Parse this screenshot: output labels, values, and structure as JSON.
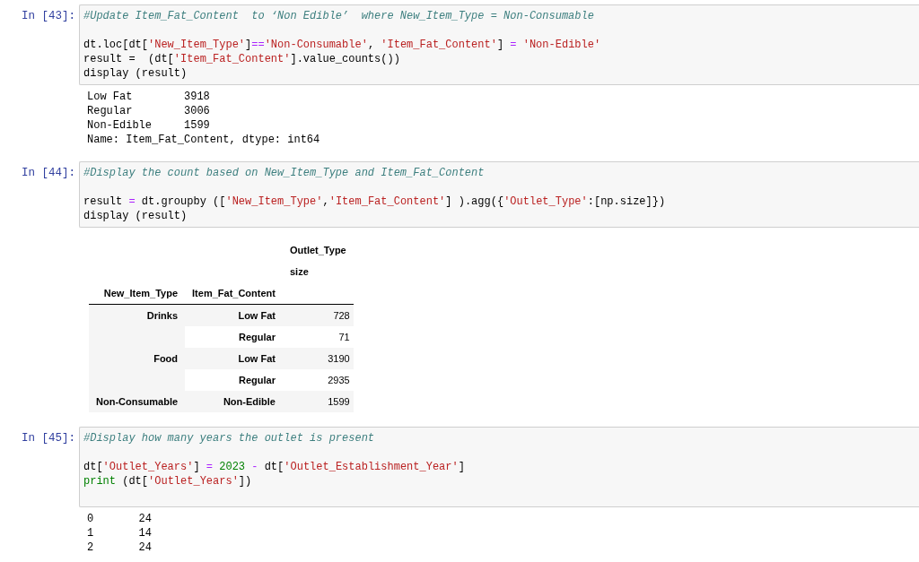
{
  "cells": [
    {
      "prompt": "In [43]:",
      "trailing_blank": false,
      "code": [
        [
          {
            "tokens": [
              {
                "kind": "comment",
                "text": "#Update Item_Fat_Content  to ‘Non Edible’  where New_Item_Type = Non-Consumable"
              }
            ]
          }
        ],
        [
          {
            "tokens": [
              {
                "kind": "name",
                "text": "dt.loc[dt["
              },
              {
                "kind": "string",
                "text": "'New_Item_Type'"
              },
              {
                "kind": "name",
                "text": "]"
              },
              {
                "kind": "op",
                "text": "=="
              },
              {
                "kind": "string",
                "text": "'Non-Consumable'"
              },
              {
                "kind": "name",
                "text": ", "
              },
              {
                "kind": "string",
                "text": "'Item_Fat_Content'"
              },
              {
                "kind": "name",
                "text": "] "
              },
              {
                "kind": "op",
                "text": "="
              },
              {
                "kind": "string",
                "text": " 'Non-Edible'"
              }
            ]
          },
          {
            "tokens": [
              {
                "kind": "name",
                "text": "result =  (dt["
              },
              {
                "kind": "string",
                "text": "'Item_Fat_Content'"
              },
              {
                "kind": "name",
                "text": "].value_counts())"
              }
            ]
          },
          {
            "tokens": [
              {
                "kind": "name",
                "text": "display (result)"
              }
            ]
          }
        ]
      ],
      "output": {
        "kind": "text",
        "lines": [
          "Low Fat        3918",
          "Regular        3006",
          "Non-Edible     1599",
          "Name: Item_Fat_Content, dtype: int64"
        ]
      }
    },
    {
      "prompt": "In [44]:",
      "trailing_blank": false,
      "code": [
        [
          {
            "tokens": [
              {
                "kind": "comment",
                "text": "#Display the count based on New_Item_Type and Item_Fat_Content"
              }
            ]
          }
        ],
        [
          {
            "tokens": [
              {
                "kind": "name",
                "text": "result "
              },
              {
                "kind": "op",
                "text": "="
              },
              {
                "kind": "name",
                "text": " dt.groupby (["
              },
              {
                "kind": "string",
                "text": "'New_Item_Type'"
              },
              {
                "kind": "name",
                "text": ","
              },
              {
                "kind": "string",
                "text": "'Item_Fat_Content'"
              },
              {
                "kind": "name",
                "text": "] ).agg({"
              },
              {
                "kind": "string",
                "text": "'Outlet_Type'"
              },
              {
                "kind": "name",
                "text": ":[np.size]})"
              }
            ]
          },
          {
            "tokens": [
              {
                "kind": "name",
                "text": "display (result)"
              }
            ]
          }
        ]
      ],
      "output": {
        "kind": "table",
        "value_header": "Outlet_Type",
        "value_subheader": "size",
        "index_names": [
          "New_Item_Type",
          "Item_Fat_Content"
        ],
        "groups": [
          {
            "label": "Drinks",
            "rows": [
              {
                "label": "Low Fat",
                "value": "728"
              },
              {
                "label": "Regular",
                "value": "71"
              }
            ]
          },
          {
            "label": "Food",
            "rows": [
              {
                "label": "Low Fat",
                "value": "3190"
              },
              {
                "label": "Regular",
                "value": "2935"
              }
            ]
          },
          {
            "label": "Non-Consumable",
            "rows": [
              {
                "label": "Non-Edible",
                "value": "1599"
              }
            ]
          }
        ]
      }
    },
    {
      "prompt": "In [45]:",
      "trailing_blank": true,
      "code": [
        [
          {
            "tokens": [
              {
                "kind": "comment",
                "text": "#Display how many years the outlet is present"
              }
            ]
          }
        ],
        [
          {
            "tokens": [
              {
                "kind": "name",
                "text": "dt["
              },
              {
                "kind": "string",
                "text": "'Outlet_Years'"
              },
              {
                "kind": "name",
                "text": "] "
              },
              {
                "kind": "op",
                "text": "="
              },
              {
                "kind": "number",
                "text": " 2023 "
              },
              {
                "kind": "op",
                "text": "-"
              },
              {
                "kind": "name",
                "text": " dt["
              },
              {
                "kind": "string",
                "text": "'Outlet_Establishment_Year'"
              },
              {
                "kind": "name",
                "text": "]"
              }
            ]
          },
          {
            "tokens": [
              {
                "kind": "builtin",
                "text": "print"
              },
              {
                "kind": "name",
                "text": " (dt["
              },
              {
                "kind": "string",
                "text": "'Outlet_Years'"
              },
              {
                "kind": "name",
                "text": "])"
              }
            ]
          }
        ]
      ],
      "output": {
        "kind": "text",
        "lines": [
          "0       24",
          "1       14",
          "2       24"
        ]
      }
    }
  ]
}
